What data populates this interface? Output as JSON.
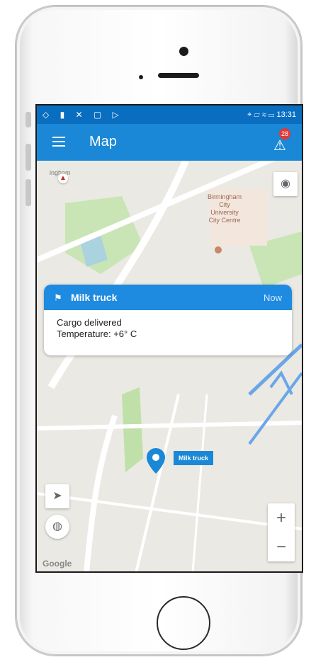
{
  "status": {
    "time": "13:31",
    "left_icons": "◇ ▮ ✕ ▢ ▷",
    "right_icons": "⌖ ▱ ≋ ▭"
  },
  "appbar": {
    "title": "Map",
    "badge_count": "28"
  },
  "notification": {
    "title": "Milk truck",
    "time": "Now",
    "line1": "Cargo delivered",
    "line2": "Temperature: +6° C"
  },
  "map": {
    "pin_label": "Milk truck",
    "poi_lines": [
      "Birmingham",
      "City",
      "University",
      "City Centre"
    ],
    "street_top": "ingham",
    "google": "Google",
    "zoom_in": "+",
    "zoom_out": "−"
  },
  "icons": {
    "menu": "hamburger-icon",
    "alert": "alert-icon",
    "flag": "flag-icon",
    "compass": "compass-icon",
    "locate": "my-location-icon",
    "navigate": "navigation-arrow-icon",
    "globe": "globe-icon",
    "pin": "map-pin-icon"
  },
  "colors": {
    "statusbar": "#0a6ec0",
    "appbar": "#1a88d6",
    "card_header": "#1e8ae0",
    "badge": "#e53935",
    "pin": "#1a88d6"
  }
}
